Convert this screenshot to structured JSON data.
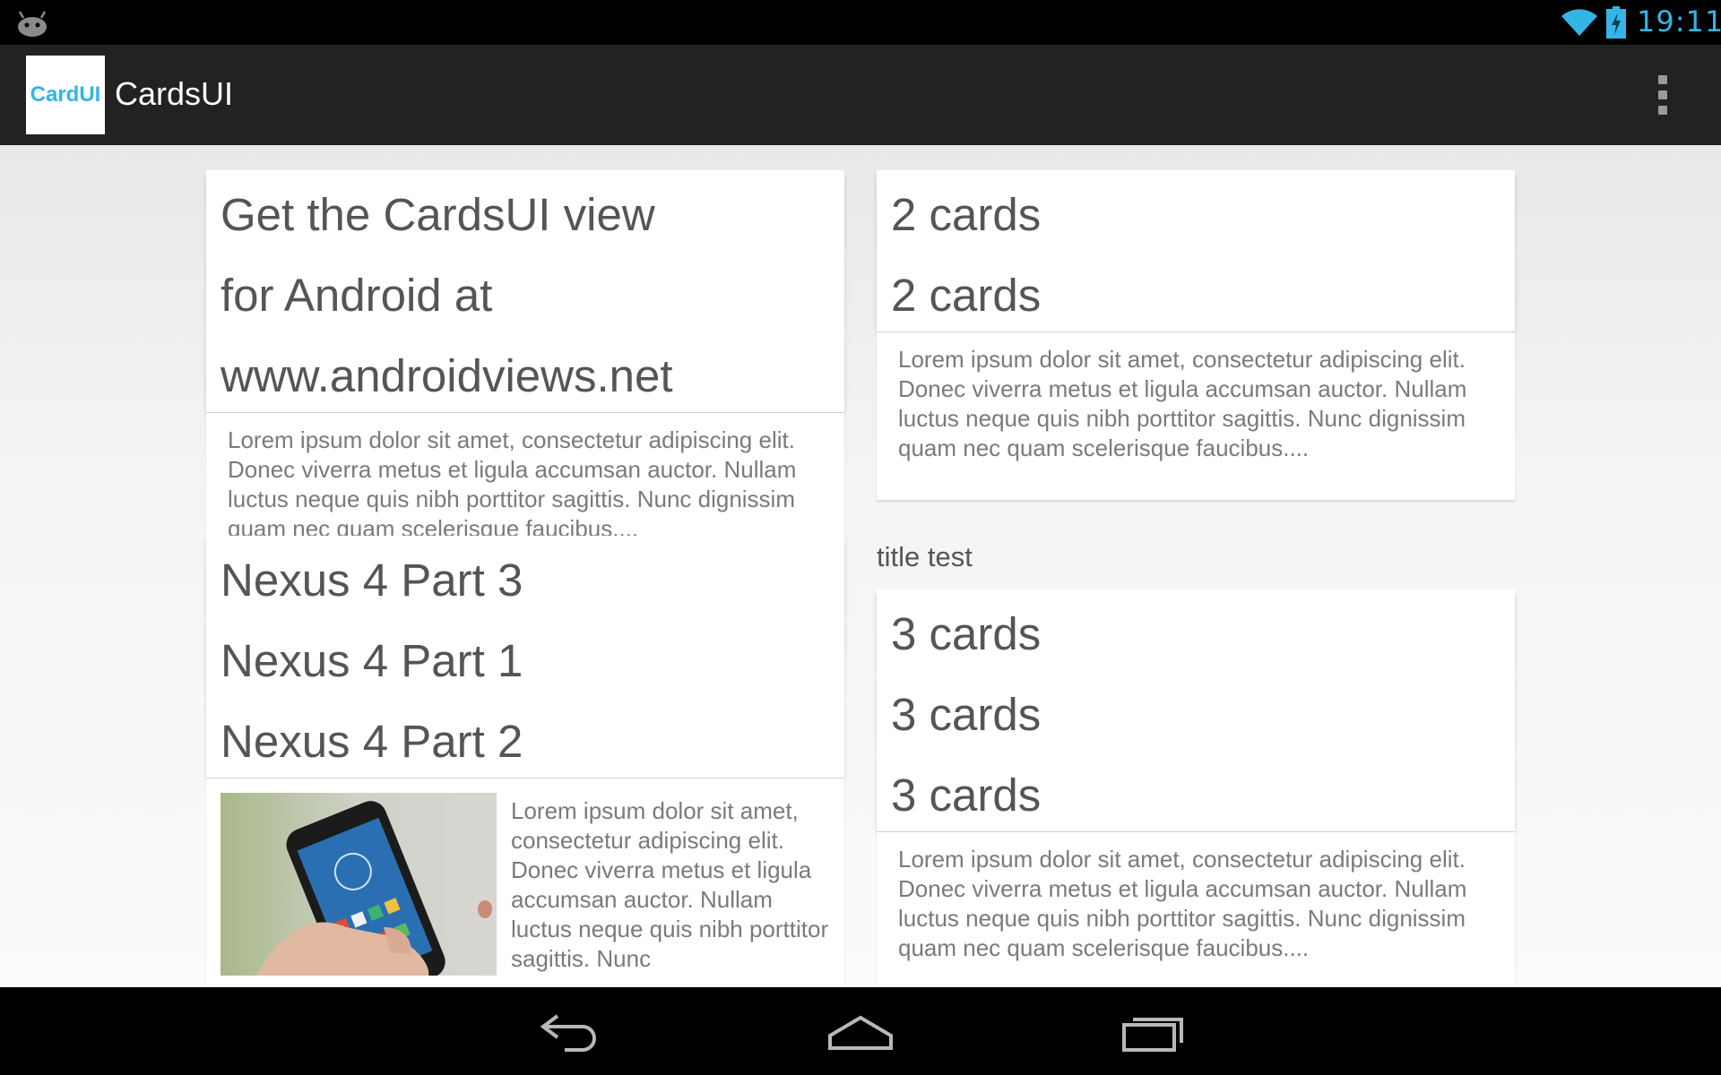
{
  "status_bar": {
    "time": "19:11",
    "accent": "#33b5e5"
  },
  "action_bar": {
    "logo_text": "CardUI",
    "title": "CardsUI"
  },
  "left_column": {
    "stack1": {
      "headers": [
        "Get the CardsUI view",
        "for Android at",
        "www.androidviews.net"
      ],
      "body": "Lorem ipsum dolor sit amet, consectetur adipiscing elit. Donec viverra metus et ligula accumsan auctor. Nullam luctus neque quis nibh porttitor sagittis. Nunc dignissim quam nec quam scelerisque faucibus...."
    },
    "stack2": {
      "headers": [
        "Nexus 4 Part 3",
        "Nexus 4 Part 1",
        "Nexus 4 Part 2"
      ],
      "body": "Lorem ipsum dolor sit amet, consectetur adipiscing elit. Donec viverra metus et ligula accumsan auctor. Nullam luctus neque quis nibh porttitor sagittis. Nunc"
    }
  },
  "right_column": {
    "stack1": {
      "headers": [
        "2 cards",
        "2 cards"
      ],
      "body": "Lorem ipsum dolor sit amet, consectetur adipiscing elit. Donec viverra metus et ligula accumsan auctor. Nullam luctus neque quis nibh porttitor sagittis. Nunc dignissim quam nec quam scelerisque faucibus...."
    },
    "section_title": "title test",
    "stack2": {
      "headers": [
        "3 cards",
        "3 cards",
        "3 cards"
      ],
      "body": "Lorem ipsum dolor sit amet, consectetur adipiscing elit. Donec viverra metus et ligula accumsan auctor. Nullam luctus neque quis nibh porttitor sagittis. Nunc dignissim quam nec quam scelerisque faucibus...."
    }
  },
  "icons": [
    "android-icon",
    "wifi-icon",
    "battery-icon",
    "overflow-menu-icon",
    "back-icon",
    "home-icon",
    "recent-apps-icon"
  ]
}
